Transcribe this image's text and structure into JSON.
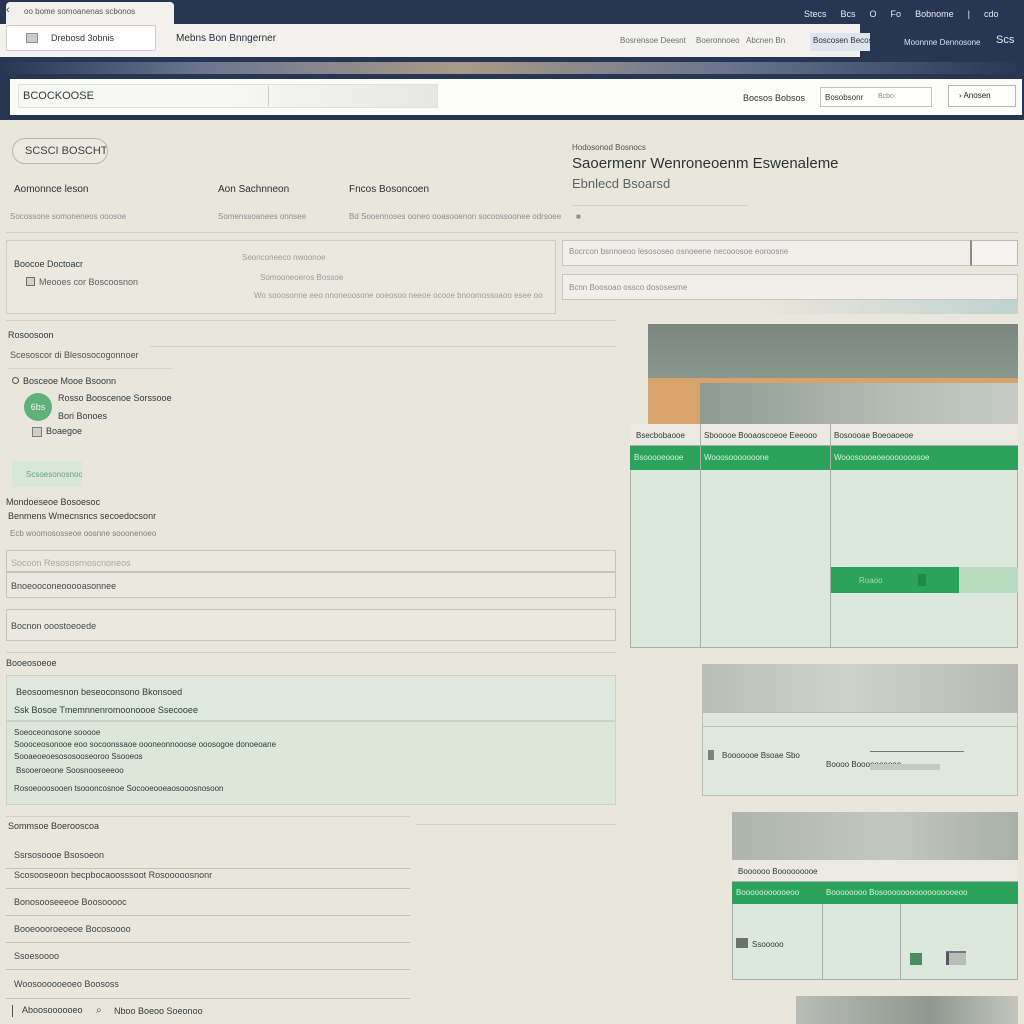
{
  "browser": {
    "tab_title": "oo bome somoanenas scbonos",
    "top_menu": [
      "Stecs",
      "Bcs",
      "O",
      "Fo",
      "Bobnome",
      "|",
      "cdo"
    ],
    "address_tab": "Drebosd 3obnis",
    "app_name": "Mebns Bon Bnngerner",
    "top_links": [
      "Bosrensoe Deesnt",
      "Boeronnoeo",
      "Abcnen Bn"
    ],
    "top_right_box": "Boscosen Becoss",
    "top_right_link": "Moonnne Dennosone",
    "top_right_tag": "Scs"
  },
  "toolbar": {
    "search_value": "BCOCKOOSE",
    "status_label": "Bocsos Bobsos",
    "status_value": "Bosobsonr",
    "status_aux": "Bcbo",
    "action_label": "Anosen"
  },
  "filters": {
    "chip_label": "SCSCI BOSCHTE",
    "columns": [
      {
        "head": "Aomonnce leson",
        "sub": "Socossone somoneneos ooosoe"
      },
      {
        "head": "Aon Sachnneon",
        "sub": "Somenssoanees onnsee"
      },
      {
        "head": "Fncos Bosoncoen",
        "sub": "Bd Sooennoses ooneo ooasooenon socoossoonee odrsoee"
      }
    ],
    "card_title": "Boocoe Doctoacr",
    "card_option": "Meooes cor Boscoosnon",
    "card_hint_1": "Seonconeeco nwoonoe",
    "card_hint_2": "Somooneoeros Bossoe",
    "card_hint_3": "Wo sooosonne eeo nnoneoosone ooeosoo neeoe ocooe bnoomossoaoo esee oo",
    "input_1_placeholder": "Bocrcon bsnnoeoo lesososeo osnoeene necooosoe eoroosne",
    "input_2_placeholder": "Bcnn Boosoao ossco dososesme"
  },
  "heading": {
    "subtitle": "Hodosonod Bosnocs",
    "title_line_1": "Saoermenr Wenroneoenm Eswenaleme",
    "title_line_2": "Ebnlecd Bsoarsd"
  },
  "section_1": {
    "title": "Rosoosoon",
    "subtitle": "Scesoscor di Blesosocogonnoer",
    "row_label": "Bosceoe Mooe Bsoonn",
    "profile_name": "Rosso Booscenoe  Sorssooe",
    "profile_role": "Bori Bonoes",
    "avatar_text": "6bs",
    "toggle_label": "Boaegoe",
    "green_button": "Scsoesonosnoo"
  },
  "section_2": {
    "title": "Mondoeseoe Bosoesoc",
    "subtitle": "Benmens Wmecnsncs secoedocsonr",
    "hint": "Ecb woomososseoe oosnne sooonenoeo",
    "field_1": "Socoon Resososrnoscnoneos",
    "field_2": "Bnoeooconeooooasonnee",
    "field_3": "Bocnon ooostoeoede"
  },
  "section_3": {
    "title": "Booeosoeoe",
    "panel_title": "Beosoomesnon beseoconsono  Bkonsoed",
    "panel_subtitle": "Ssk Bosoe  Tmemnnenromoonoooe  Ssecooee",
    "body_lines": [
      "Soeoceonosone  sooooe",
      "Soooceosonooe  eoo socoonssaoe oooneonnooose ooosogoe donoeoane",
      "Sooaeoeoesososooseoroo  Ssooeos",
      "Bsooeroeone  Soosnooseeeoo",
      "Rosoeooosooen  tsoooncosnoe  Socooeooeaosooosnosoon"
    ]
  },
  "section_4": {
    "title": "Sommsoe  Boerooscoa",
    "items": [
      "Ssrsosoooe Bsosoeon",
      "Scosooseoon  becpbocaoosssoot  Rosooooosnonr",
      "Bonosooseeeoe  Boosooooc",
      "Booeoooroeoeoe  Bocosoooo",
      "Ssoesoooo",
      "Woosoooooeoeo  Boososs"
    ],
    "footer_left": "Aboosoooooeo",
    "footer_right": "Nboo  Boeoo  Soeonoo"
  },
  "grid_1": {
    "headers": [
      "Bsecbobaooe",
      "Sbooooe Booaoscoeoe Eeeooo",
      "Bosoooae Boeoaoeoe"
    ],
    "green_row": [
      "Bsooooeoooe",
      "Wooosooooooone",
      "Wooosoooeoeooooooosoe"
    ],
    "button": "Roaoo"
  },
  "card_2": {
    "label": "Booooooe  Bsoae Sbo",
    "sublabel": "Boooo  Booooooeooo"
  },
  "grid_2": {
    "header": "Boooooo Booooooooe",
    "green_row": [
      "Booooooooooeoo",
      "Boooooooo Bosooooooooooooooooeoo"
    ],
    "cell_label": "Ssooooo"
  },
  "colors": {
    "navy": "#273653",
    "accent_green": "#2ba35a",
    "soft_green": "#dce6d9",
    "page_bg": "#e9e6dc"
  }
}
